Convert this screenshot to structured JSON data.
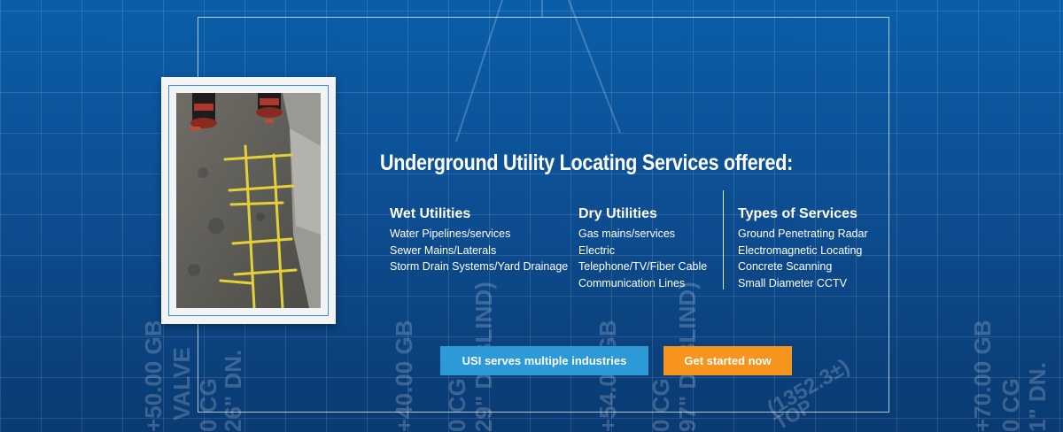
{
  "colors": {
    "background": "#0d4f93",
    "primary_button": "#2b9ad6",
    "secondary_button": "#f7941d",
    "text": "#ffffff"
  },
  "section": {
    "title": "Underground Utility Locating Services offered:",
    "columns": [
      {
        "heading": "Wet Utilities",
        "items": [
          "Water Pipelines/services",
          "Sewer Mains/Laterals",
          "Storm Drain Systems/Yard Drainage"
        ]
      },
      {
        "heading": "Dry Utilities",
        "items": [
          "Gas mains/services",
          "Electric",
          "Telephone/TV/Fiber Cable",
          "Communication Lines"
        ]
      },
      {
        "heading": "Types of Services",
        "items": [
          "Ground Penetrating Radar",
          "Electromagnetic Locating",
          "Concrete Scanning",
          "Small Diameter CCTV"
        ]
      }
    ]
  },
  "buttons": {
    "industries": "USI serves multiple industries",
    "get_started": "Get started now"
  },
  "background_text": {
    "b1": "+50.00 GB",
    "b2": "VALVE",
    "b3": "0 CG",
    "b4": "26\" DN.",
    "b5": "+40.00 GB",
    "b6": "0 CG",
    "b7": "29\" DI BLIND)",
    "b8": "+54.00 GB",
    "b9": "0 CG",
    "b10": "97\" DI BLIND)",
    "b11": "(1352.3±)",
    "b12": "TOP",
    "b13": "+70.00 GB",
    "b14": "0 CG",
    "b15": "1\" DN."
  },
  "photo": {
    "icon": "utility-markings-photo"
  }
}
